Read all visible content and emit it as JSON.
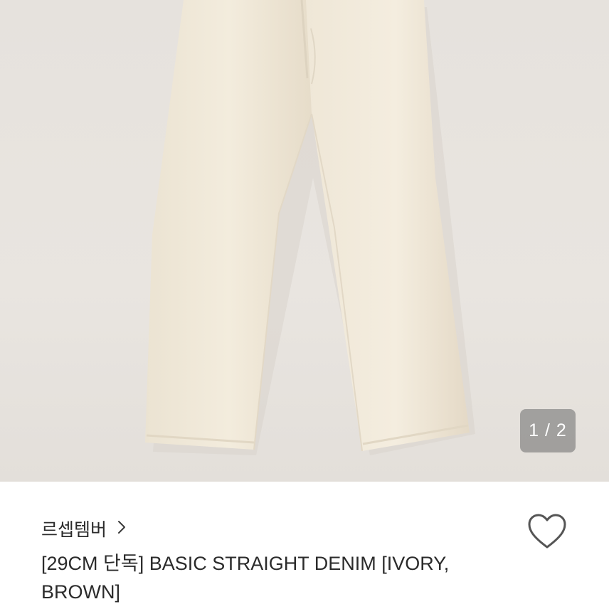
{
  "gallery": {
    "current_page": "1",
    "total_pages": "2",
    "counter_text": "1 / 2",
    "background_color": "#e7e3de",
    "product_color": "#f1eadb"
  },
  "product": {
    "brand": "르셉템버",
    "title": "[29CM 단독] BASIC STRAIGHT DENIM [IVORY, BROWN]"
  },
  "icons": {
    "brand_link": "chevron-right-icon",
    "like": "heart-outline-icon"
  }
}
